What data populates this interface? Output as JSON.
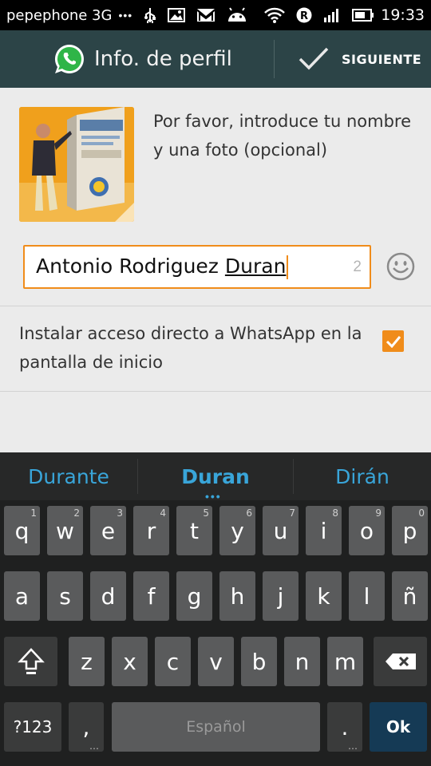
{
  "status_bar": {
    "carrier": "pepephone 3G",
    "dots": "•••",
    "time": "19:33"
  },
  "action_bar": {
    "title": "Info. de perfil",
    "next_label": "SIGUIENTE"
  },
  "profile": {
    "instructions": "Por favor, introduce tu nombre y una foto (opcional)",
    "name_value": "Antonio Rodriguez ",
    "name_composing": "Duran",
    "char_counter": "2"
  },
  "shortcut": {
    "label": "Instalar acceso directo a WhatsApp en la pantalla de inicio",
    "checked": true
  },
  "keyboard": {
    "suggestions": [
      "Durante",
      "Duran",
      "Dirán"
    ],
    "row1": [
      {
        "key": "q",
        "hint": "1"
      },
      {
        "key": "w",
        "hint": "2"
      },
      {
        "key": "e",
        "hint": "3"
      },
      {
        "key": "r",
        "hint": "4"
      },
      {
        "key": "t",
        "hint": "5"
      },
      {
        "key": "y",
        "hint": "6"
      },
      {
        "key": "u",
        "hint": "7"
      },
      {
        "key": "i",
        "hint": "8"
      },
      {
        "key": "o",
        "hint": "9"
      },
      {
        "key": "p",
        "hint": "0"
      }
    ],
    "row2": [
      "a",
      "s",
      "d",
      "f",
      "g",
      "h",
      "j",
      "k",
      "l",
      "ñ"
    ],
    "row3": [
      "z",
      "x",
      "c",
      "v",
      "b",
      "n",
      "m"
    ],
    "symbols_label": "?123",
    "comma": ",",
    "space_label": "Español",
    "period": ".",
    "ok_label": "Ok"
  },
  "colors": {
    "accent": "#f08c1a",
    "action_bar": "#2c4447",
    "suggestion": "#39a5d9",
    "ok_key": "#153a55"
  }
}
